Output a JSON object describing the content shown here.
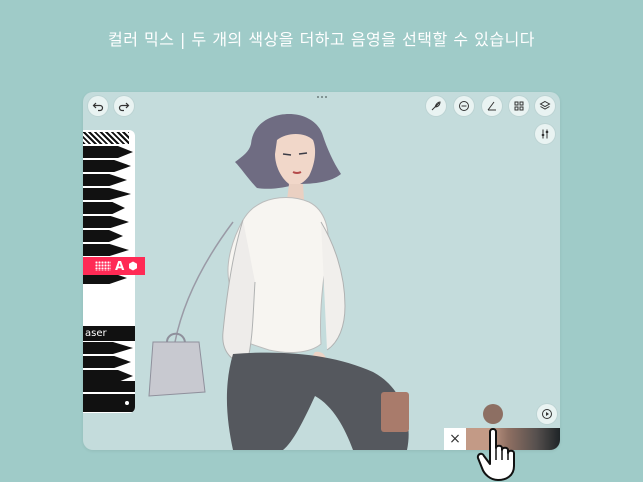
{
  "headline": "컬러 믹스 | 두 개의 색상을 더하고 음영을 선택할 수 있습니다",
  "toolbar": {
    "eraser_label": "aser",
    "accent_letter": "A"
  },
  "icons": {
    "undo": "undo-icon",
    "redo": "redo-icon",
    "brush": "feather-icon",
    "minus": "minus-circle-icon",
    "guides": "angle-icon",
    "grid": "grid-icon",
    "layers": "layers-icon",
    "adjust": "sliders-icon",
    "play": "play-icon",
    "close": "close-icon"
  },
  "color_mix": {
    "close_label": "×",
    "start_color": "#c39a86",
    "end_color": "#1e2427",
    "selected_color": "#8d6f63"
  },
  "colors": {
    "background": "#9fcbc8",
    "canvas": "#c4dcdc",
    "accent": "#ff2a55"
  }
}
